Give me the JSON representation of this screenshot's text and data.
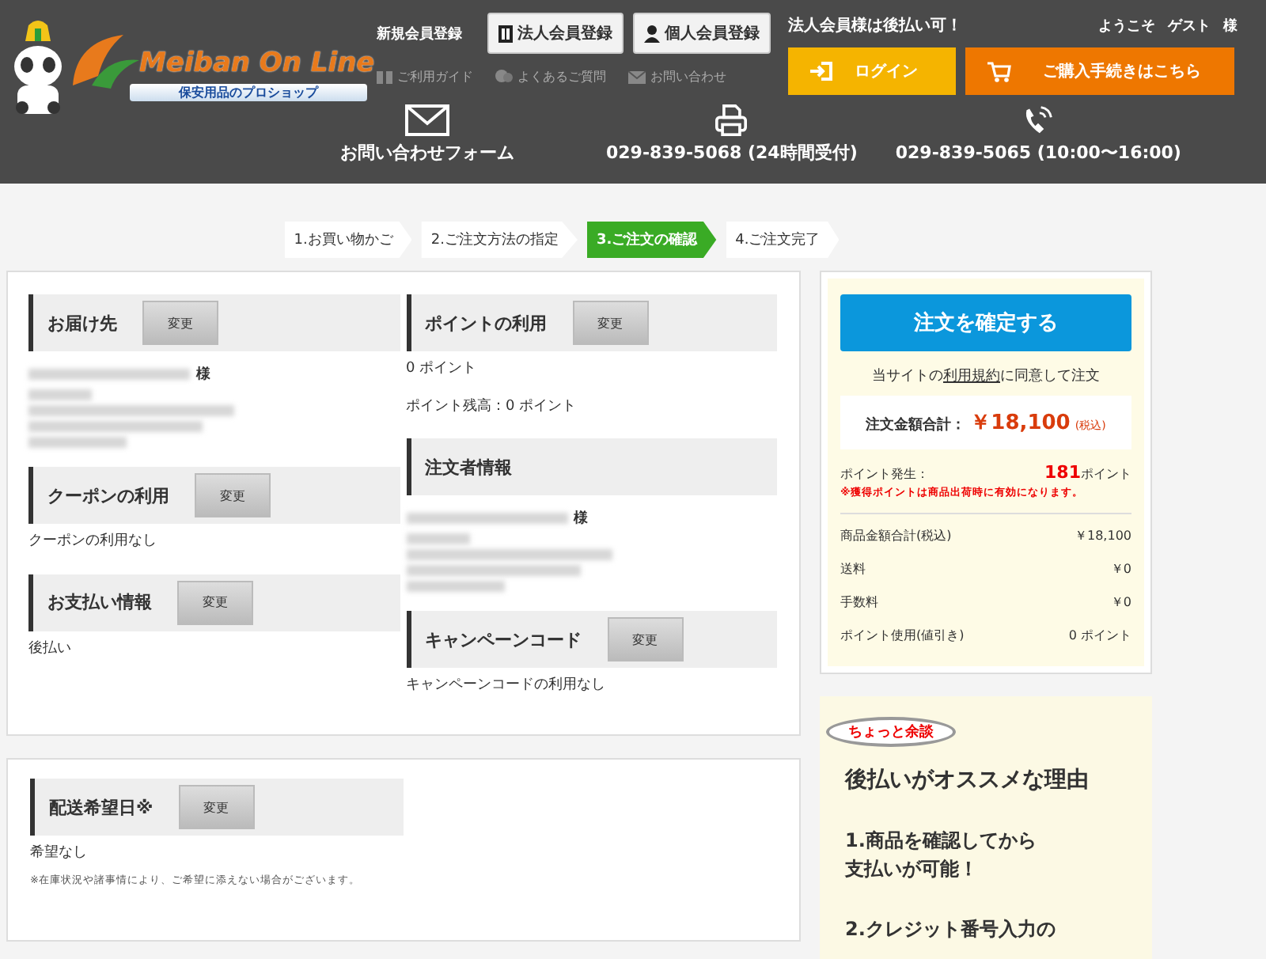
{
  "header": {
    "logo": {
      "name": "Meiban On Line",
      "tagline": "保安用品のプロショップ"
    },
    "register_label": "新規会員登録",
    "register_buttons": [
      {
        "label": "法人会員登録",
        "kind": "corporate"
      },
      {
        "label": "個人会員登録",
        "kind": "individual"
      }
    ],
    "notice": "法人会員様は後払い可！",
    "welcome": [
      "ようこそ",
      "ゲスト",
      "様"
    ],
    "nav_links": [
      {
        "label": "ご利用ガイド",
        "kind": "guide"
      },
      {
        "label": "よくあるご質問",
        "kind": "faq"
      },
      {
        "label": "お問い合わせ",
        "kind": "mail"
      }
    ],
    "login": "ログイン",
    "checkout": "ご購入手続きはこちら",
    "contacts": [
      {
        "kind": "mail",
        "label": "お問い合わせフォーム"
      },
      {
        "kind": "fax",
        "label": "029-839-5068 (24時間受付)"
      },
      {
        "kind": "phone",
        "label": "029-839-5065 (10:00〜16:00)"
      }
    ]
  },
  "steps": [
    {
      "label": "1.お買い物かご",
      "selected": false
    },
    {
      "label": "2.ご注文方法の指定",
      "selected": false
    },
    {
      "label": "3.ご注文の確認",
      "selected": true
    },
    {
      "label": "4.ご注文完了",
      "selected": false
    }
  ],
  "order_columns": [
    [
      {
        "title": "お届け先",
        "button": "変更",
        "honorific": "様"
      },
      {
        "title": "クーポンの利用",
        "button": "変更",
        "lines": [
          "クーポンの利用なし"
        ]
      },
      {
        "title": "お支払い情報",
        "button": "変更",
        "lines": [
          "後払い"
        ]
      }
    ],
    [
      {
        "title": "ポイントの利用",
        "button": "変更",
        "lines": [
          "0 ポイント",
          "ポイント残高：0 ポイント"
        ]
      },
      {
        "title": "注文者情報",
        "honorific": "様"
      },
      {
        "title": "キャンペーンコード",
        "button": "変更",
        "lines": [
          "キャンペーンコードの利用なし"
        ]
      }
    ]
  ],
  "delivery": {
    "title": "配送希望日※",
    "button": "変更",
    "value": "希望なし",
    "note": "※在庫状況や諸事情により、ご希望に添えない場合がございます。"
  },
  "summary": {
    "confirm": "注文を確定する",
    "agree_before": "当サイトの",
    "terms_link": "利用規約",
    "agree_after": "に同意して注文",
    "total_label": "注文金額合計：",
    "total": "￥18,100",
    "tax": "(税込)",
    "points_label": "ポイント発生：",
    "points_value": "181",
    "points_unit": "ポイント",
    "points_note": "※獲得ポイントは商品出荷時に有効になります。",
    "rows": [
      {
        "label": "商品金額合計(税込)",
        "value": "￥18,100"
      },
      {
        "label": "送料",
        "value": "￥0"
      },
      {
        "label": "手数料",
        "value": "￥0"
      },
      {
        "label": "ポイント使用(値引き)",
        "value": "0 ポイント"
      }
    ]
  },
  "aside": {
    "badge": "ちょっと余談",
    "title": "後払いがオススメな理由",
    "items": [
      {
        "lines": [
          "1.商品を確認してから",
          "支払いが可能！"
        ]
      },
      {
        "lines": [
          "2.クレジット番号入力の"
        ]
      }
    ]
  }
}
